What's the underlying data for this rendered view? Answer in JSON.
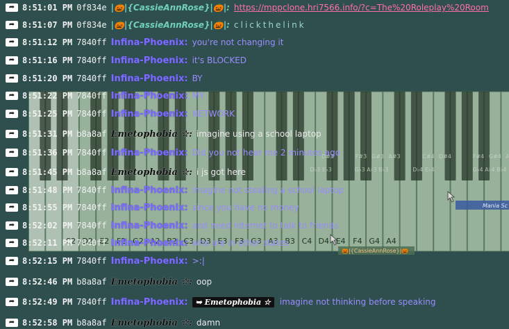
{
  "piano": {
    "sharp_labels": [
      "D#3",
      "F#3",
      "G#3",
      "A#3",
      "C#4",
      "D#4",
      "F#4",
      "G#4",
      "A#4"
    ],
    "flat_labels": [
      "D♭3 E♭3",
      "G♭3 A♭3 B♭3",
      "D♭4 E♭4",
      "G♭4 A♭4 B♭4"
    ],
    "white_labels": [
      "C2",
      "D2",
      "E2",
      "F2",
      "G2",
      "A2",
      "B2",
      "C3",
      "D3",
      "E3",
      "F3",
      "G3",
      "A3",
      "B3",
      "C4",
      "D4",
      "E4",
      "F4",
      "G4",
      "A4"
    ],
    "cursor_name": "Mania Sc",
    "cursor_label": "🎃|{CassieAnnRose}|🎃"
  },
  "messages": [
    {
      "time": "8:51:01 PM",
      "uid": "0f834e",
      "name": "|🎃|{CassieAnnRose}|🎃|:",
      "text": "https://mppclone.hri7566.info/?c=The%20Roleplay%20Room",
      "type": "link",
      "style": "ansu"
    },
    {
      "time": "8:51:07 PM",
      "uid": "0f834e",
      "name": "|🎃|{CassieAnnRose}|🎃|:",
      "text": "clickthelink",
      "type": "text",
      "style": "ansu"
    },
    {
      "time": "8:51:12 PM",
      "uid": "7840ff",
      "name": "Infina-Phoenix:",
      "text": "you're not changing it",
      "type": "text",
      "style": "phoenix"
    },
    {
      "time": "8:51:16 PM",
      "uid": "7840ff",
      "name": "Infina-Phoenix:",
      "text": "it's BLOCKED",
      "type": "text",
      "style": "phoenix"
    },
    {
      "time": "8:51:20 PM",
      "uid": "7840ff",
      "name": "Infina-Phoenix:",
      "text": "BY",
      "type": "text",
      "style": "phoenix"
    },
    {
      "time": "8:51:22 PM",
      "uid": "7840ff",
      "name": "Infina-Phoenix:",
      "text": "MY",
      "type": "text",
      "style": "phoenix"
    },
    {
      "time": "8:51:25 PM",
      "uid": "7840ff",
      "name": "Infina-Phoenix:",
      "text": "NETWORK",
      "type": "text",
      "style": "phoenix"
    },
    {
      "time": "8:51:31 PM",
      "uid": "b8a8af",
      "name": "Emetophobia ☆:",
      "text": "imagine using a school laptop",
      "type": "text",
      "style": "emeto"
    },
    {
      "time": "8:51:36 PM",
      "uid": "7840ff",
      "name": "Infina-Phoenix:",
      "text": "Did you not hear me 2 minutes ago",
      "type": "text",
      "style": "phoenix"
    },
    {
      "time": "8:51:45 PM",
      "uid": "b8a8af",
      "name": "Emetophobia ☆:",
      "text": "i js got here",
      "type": "text",
      "style": "emeto"
    },
    {
      "time": "8:51:48 PM",
      "uid": "7840ff",
      "name": "Infina-Phoenix:",
      "text": "imagine not stealing a school laptop",
      "type": "text",
      "style": "phoenix"
    },
    {
      "time": "8:51:55 PM",
      "uid": "7840ff",
      "name": "Infina-Phoenix:",
      "text": "since you have no money",
      "type": "text",
      "style": "phoenix"
    },
    {
      "time": "8:52:02 PM",
      "uid": "7840ff",
      "name": "Infina-Phoenix:",
      "text": "and need internet to talk to friends",
      "type": "text",
      "style": "phoenix"
    },
    {
      "time": "8:52:11 PM",
      "uid": "7840ff",
      "name": "Infina-Phoenix:",
      "text": "who are in other states",
      "type": "text",
      "style": "phoenix"
    },
    {
      "time": "8:52:15 PM",
      "uid": "7840ff",
      "name": "Infina-Phoenix:",
      "text": ">:|",
      "type": "text",
      "style": "phoenix"
    },
    {
      "time": "8:52:46 PM",
      "uid": "b8a8af",
      "name": "Emetophobia ☆:",
      "text": "oop",
      "type": "text",
      "style": "emeto"
    },
    {
      "time": "8:52:49 PM",
      "uid": "7840ff",
      "name": "Infina-Phoenix:",
      "mention": "➥ Emetophobia ☆",
      "text": "imagine not thinking before speaking",
      "type": "reply",
      "style": "phoenix"
    },
    {
      "time": "8:52:58 PM",
      "uid": "b8a8af",
      "name": "Emetophobia ☆:",
      "text": "damn",
      "type": "text",
      "style": "emeto"
    }
  ],
  "reply_icon": "reply-arrow-icon",
  "colors": {
    "background": "#2f4f4f",
    "phoenix": "#7c6cff",
    "link": "#ff6fa8"
  }
}
